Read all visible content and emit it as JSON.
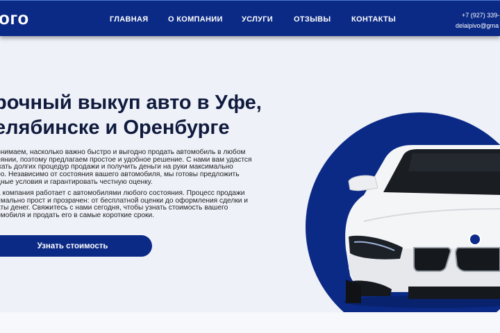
{
  "header": {
    "logo": "ого",
    "nav": [
      "ГЛАВНАЯ",
      "О КОМПАНИИ",
      "УСЛУГИ",
      "ОТЗЫВЫ",
      "КОНТАКТЫ"
    ],
    "phone": "+7 (927) 339-",
    "email": "delaipivo@gma"
  },
  "hero": {
    "title_lines": [
      "рочный выкуп авто в Уфе,",
      "елябинске и Оренбурге"
    ],
    "paragraph1": [
      "онимаем, насколько важно быстро и выгодно продать автомобиль в любом",
      "оянии, поэтому предлагаем простое и удобное решение. С нами вам удастся",
      "жать долгих процедур продажи и получить деньги на руки максимально",
      "ро. Независимо от состояния вашего автомобиля, мы готовы предложить",
      "дные условия и гарантировать честную оценку."
    ],
    "paragraph2": [
      "а компания работает с автомобилями любого состояния. Процесс продажи",
      "имально прост и прозрачен: от бесплатной оценки до оформления сделки и",
      "аты денег. Свяжитесь с нами сегодня, чтобы узнать стоимость вашего",
      "омобиля и продать его в самые короткие сроки."
    ],
    "cta_label": "Узнать стоимость"
  },
  "colors": {
    "brand": "#0b2a86",
    "text": "#0f1a3d",
    "background": "#eef1f8"
  }
}
